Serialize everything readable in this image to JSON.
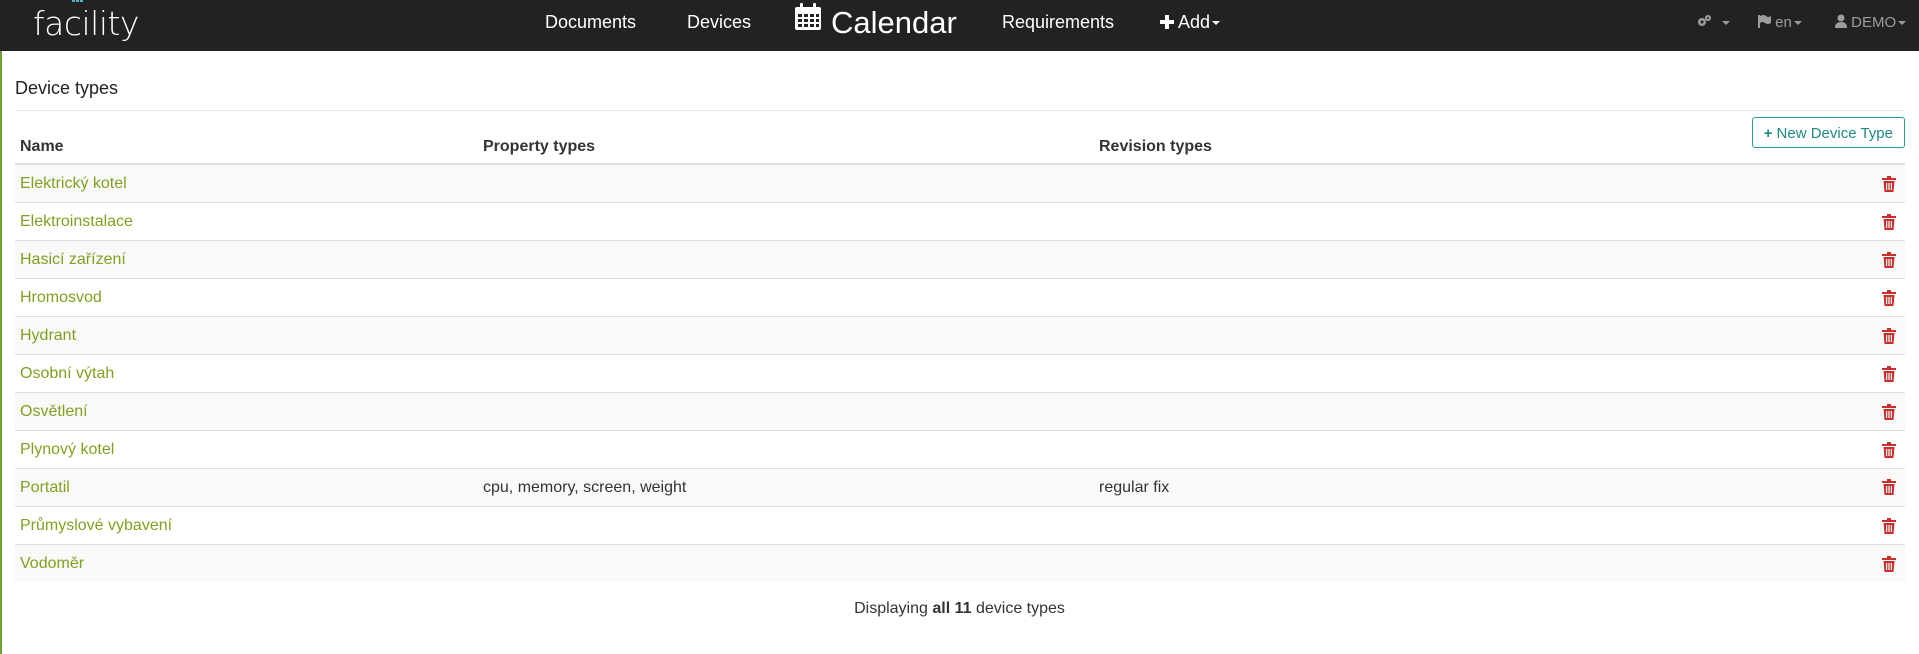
{
  "navbar": {
    "logo": "facility",
    "items": [
      "Documents",
      "Devices",
      "Calendar",
      "Requirements"
    ],
    "add_label": "Add",
    "lang": "en",
    "user": "DEMO",
    "icons": {
      "settings": "cogs-icon",
      "lang": "flag-icon",
      "user": "user-icon",
      "calendar": "calendar-icon",
      "add": "plus-icon"
    }
  },
  "page": {
    "title": "Device types"
  },
  "new_button": {
    "label": "New Device Type",
    "icon": "+"
  },
  "table": {
    "headers": [
      "Name",
      "Property types",
      "Revision types"
    ],
    "rows": [
      {
        "name": "Elektrický kotel",
        "property_types": "",
        "revision_types": ""
      },
      {
        "name": "Elektroinstalace",
        "property_types": "",
        "revision_types": ""
      },
      {
        "name": "Hasicí zařízení",
        "property_types": "",
        "revision_types": ""
      },
      {
        "name": "Hromosvod",
        "property_types": "",
        "revision_types": ""
      },
      {
        "name": "Hydrant",
        "property_types": "",
        "revision_types": ""
      },
      {
        "name": "Osobní výtah",
        "property_types": "",
        "revision_types": ""
      },
      {
        "name": "Osvětlení",
        "property_types": "",
        "revision_types": ""
      },
      {
        "name": "Plynový kotel",
        "property_types": "",
        "revision_types": ""
      },
      {
        "name": "Portatil",
        "property_types": "cpu, memory, screen, weight",
        "revision_types": "regular fix"
      },
      {
        "name": "Průmyslové vybavení",
        "property_types": "",
        "revision_types": ""
      },
      {
        "name": "Vodoměr",
        "property_types": "",
        "revision_types": ""
      }
    ]
  },
  "footer": {
    "prefix": "Displaying",
    "bold": "all 11",
    "suffix": "device types"
  },
  "colors": {
    "navbar": "#222222",
    "link": "#7fa11f",
    "delete": "#c9302c",
    "button": "#2a9d94"
  }
}
